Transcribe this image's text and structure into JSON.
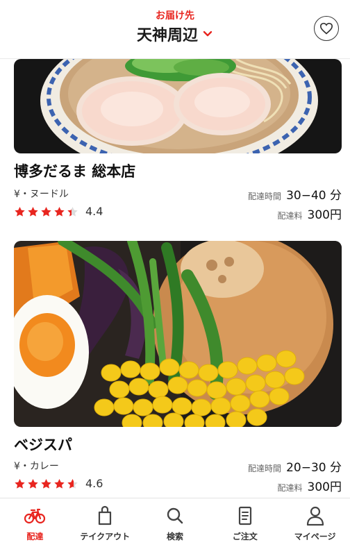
{
  "header": {
    "deliver_label": "お届け先",
    "location": "天神周辺"
  },
  "colors": {
    "accent": "#e8251f",
    "star": "#e8251f"
  },
  "restaurants": [
    {
      "name": "博多だるま 総本店",
      "genre": "¥・ヌードル",
      "rating": "4.4",
      "rating_value": 4.4,
      "delivery_time_label": "配達時間",
      "delivery_time": "30−40 分",
      "delivery_fee_label": "配達料",
      "delivery_fee": "300円",
      "photo_icon": "ramen-photo"
    },
    {
      "name": "ベジスパ",
      "genre": "¥・カレー",
      "rating": "4.6",
      "rating_value": 4.6,
      "delivery_time_label": "配達時間",
      "delivery_time": "20−30 分",
      "delivery_fee_label": "配達料",
      "delivery_fee": "300円",
      "photo_icon": "soup-curry-photo"
    }
  ],
  "nav": [
    {
      "label": "配達",
      "icon": "bicycle-icon",
      "active": true
    },
    {
      "label": "テイクアウト",
      "icon": "bag-icon",
      "active": false
    },
    {
      "label": "検索",
      "icon": "search-icon",
      "active": false
    },
    {
      "label": "ご注文",
      "icon": "receipt-icon",
      "active": false
    },
    {
      "label": "マイページ",
      "icon": "user-icon",
      "active": false
    }
  ]
}
